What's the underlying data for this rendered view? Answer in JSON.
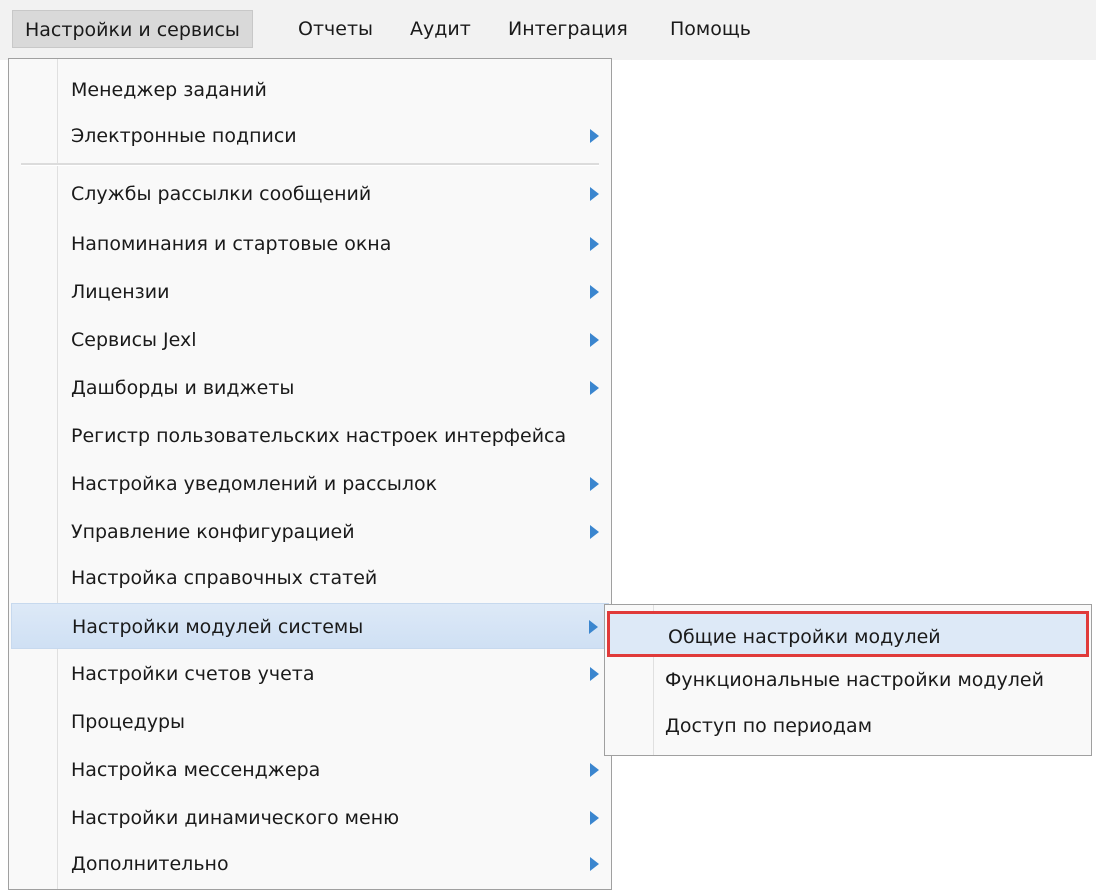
{
  "menubar": {
    "items": [
      {
        "label": "Настройки и сервисы"
      },
      {
        "label": "Отчеты"
      },
      {
        "label": "Аудит"
      },
      {
        "label": "Интеграция"
      },
      {
        "label": "Помощь"
      }
    ]
  },
  "dropdown": {
    "items": [
      {
        "label": "Менеджер заданий",
        "submenu": false
      },
      {
        "label": "Электронные подписи",
        "submenu": true
      },
      {
        "label": "Службы рассылки сообщений",
        "submenu": true
      },
      {
        "label": "Напоминания и стартовые окна",
        "submenu": true
      },
      {
        "label": "Лицензии",
        "submenu": true
      },
      {
        "label": "Сервисы Jexl",
        "submenu": true
      },
      {
        "label": "Дашборды и виджеты",
        "submenu": true
      },
      {
        "label": "Регистр пользовательских настроек интерфейса",
        "submenu": false
      },
      {
        "label": "Настройка уведомлений и рассылок",
        "submenu": true
      },
      {
        "label": "Управление конфигурацией",
        "submenu": true
      },
      {
        "label": "Настройка справочных статей",
        "submenu": false
      },
      {
        "label": "Настройки модулей системы",
        "submenu": true
      },
      {
        "label": "Настройки счетов учета",
        "submenu": true
      },
      {
        "label": "Процедуры",
        "submenu": false
      },
      {
        "label": "Настройка мессенджера",
        "submenu": true
      },
      {
        "label": "Настройки динамического меню",
        "submenu": true
      },
      {
        "label": "Дополнительно",
        "submenu": true
      }
    ]
  },
  "submenu": {
    "items": [
      {
        "label": "Общие настройки модулей"
      },
      {
        "label": "Функциональные настройки модулей"
      },
      {
        "label": "Доступ по периодам"
      }
    ]
  },
  "colors": {
    "accent_arrow": "#3b86cf",
    "highlight": "#dde9f7",
    "selection_outline": "#e03a3a"
  }
}
